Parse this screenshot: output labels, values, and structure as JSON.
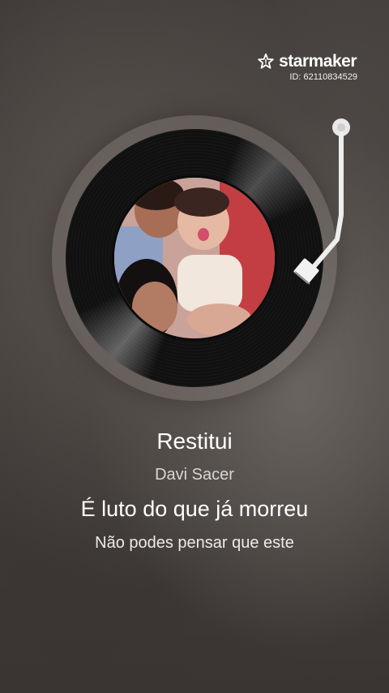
{
  "brand": {
    "name": "starmaker",
    "user_id": "ID: 62110834529"
  },
  "song": {
    "title": "Restitui",
    "artist": "Davi Sacer"
  },
  "lyrics": {
    "current": "É luto do que já morreu",
    "next": "Não podes pensar que este"
  },
  "icons": {
    "logo": "star-logo-icon",
    "record": "vinyl-record",
    "tonearm": "tonearm-icon"
  },
  "colors": {
    "text_primary": "#ffffff",
    "text_secondary": "#d8d6d4",
    "record": "#111111"
  }
}
